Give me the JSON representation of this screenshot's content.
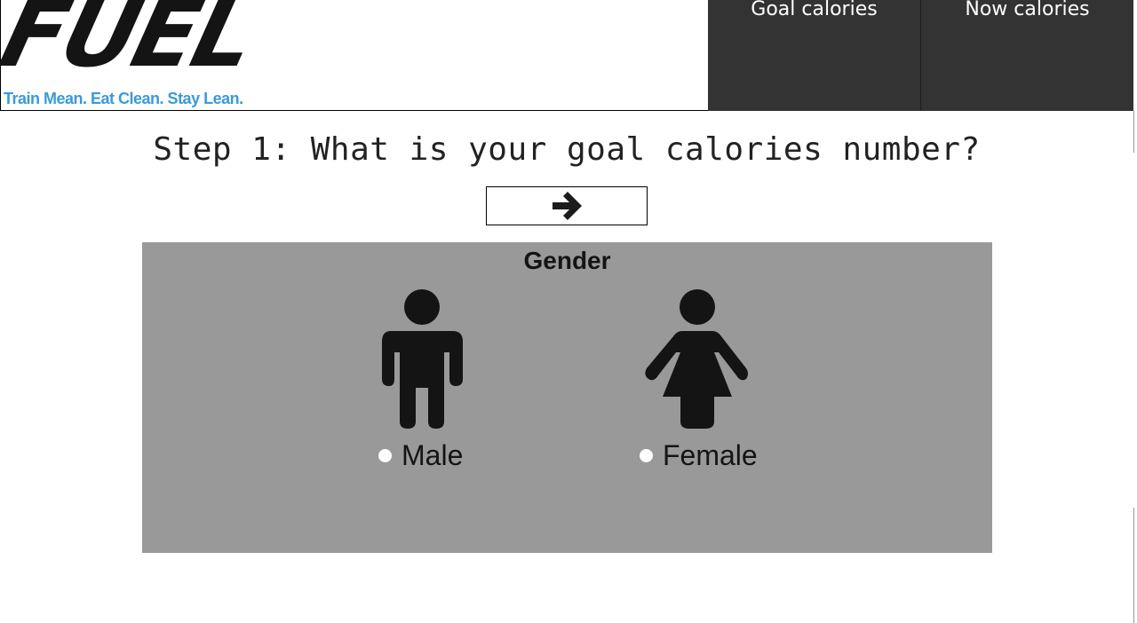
{
  "header": {
    "logo_text": "FUEL",
    "tagline": "Train Mean. Eat Clean. Stay Lean.",
    "nav": [
      {
        "label": "Goal calories"
      },
      {
        "label": "Now calories"
      }
    ]
  },
  "step": {
    "title": "Step 1: What is your goal calories number?",
    "next_icon": "arrow-right-icon"
  },
  "gender": {
    "title": "Gender",
    "options": [
      {
        "label": "Male",
        "icon": "male-person-icon",
        "selected": false
      },
      {
        "label": "Female",
        "icon": "female-person-icon",
        "selected": false
      }
    ]
  },
  "colors": {
    "nav_bg": "#333333",
    "panel_bg": "#999999",
    "tagline": "#3a9ad9",
    "icon": "#141414"
  }
}
